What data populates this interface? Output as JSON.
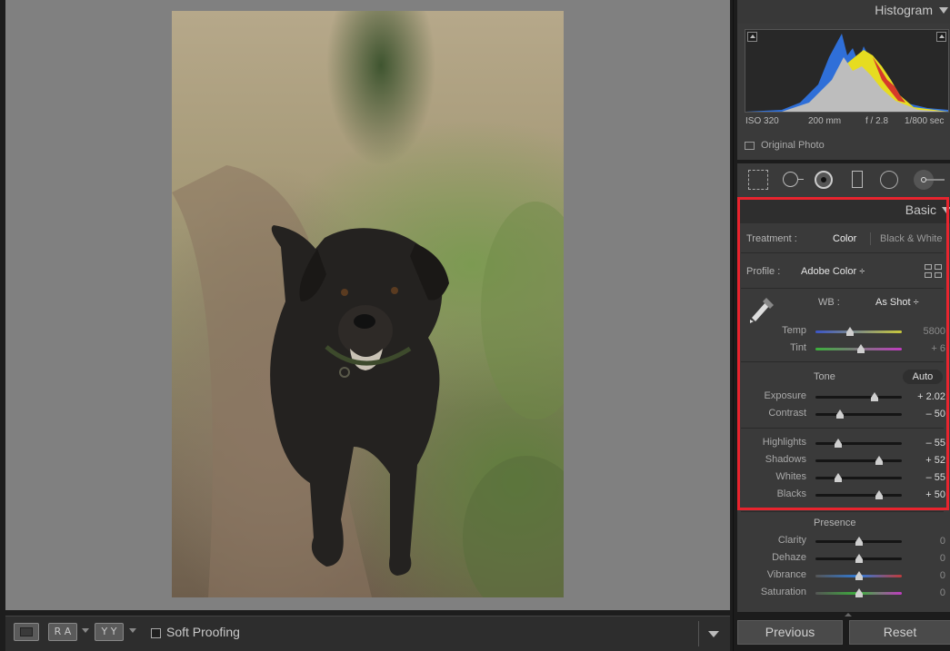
{
  "bottom_toolbar": {
    "ra_label": "R A",
    "yy_label": "Y Y",
    "soft_proofing_label": "Soft Proofing"
  },
  "histogram": {
    "title": "Histogram",
    "iso": "ISO 320",
    "focal": "200 mm",
    "aperture": "f / 2.8",
    "shutter": "1/800 sec",
    "original_photo_label": "Original Photo"
  },
  "basic": {
    "title": "Basic",
    "treatment_label": "Treatment :",
    "treatment_color": "Color",
    "treatment_bw": "Black & White",
    "profile_label": "Profile :",
    "profile_value": "Adobe Color ÷",
    "wb_label": "WB :",
    "wb_value": "As Shot ÷",
    "temp": {
      "label": "Temp",
      "value": "5800",
      "position": 0.4
    },
    "tint": {
      "label": "Tint",
      "value": "+ 6",
      "position": 0.53
    },
    "tone_label": "Tone",
    "auto_label": "Auto",
    "exposure": {
      "label": "Exposure",
      "value": "+ 2.02",
      "position": 0.68
    },
    "contrast": {
      "label": "Contrast",
      "value": "– 50",
      "position": 0.28
    },
    "highlights": {
      "label": "Highlights",
      "value": "– 55",
      "position": 0.26
    },
    "shadows": {
      "label": "Shadows",
      "value": "+ 52",
      "position": 0.74
    },
    "whites": {
      "label": "Whites",
      "value": "– 55",
      "position": 0.26
    },
    "blacks": {
      "label": "Blacks",
      "value": "+ 50",
      "position": 0.74
    },
    "presence_label": "Presence",
    "clarity": {
      "label": "Clarity",
      "value": "0",
      "position": 0.5
    },
    "dehaze": {
      "label": "Dehaze",
      "value": "0",
      "position": 0.5
    },
    "vibrance": {
      "label": "Vibrance",
      "value": "0",
      "position": 0.5
    },
    "saturation": {
      "label": "Saturation",
      "value": "0",
      "position": 0.5
    }
  },
  "footer": {
    "previous_label": "Previous",
    "reset_label": "Reset"
  },
  "colors": {
    "highlight_outline": "#e8242e",
    "panel_bg": "#3a3a3a",
    "canvas_bg": "#808080"
  },
  "icons": [
    "crop-overlay-icon",
    "spot-removal-icon",
    "red-eye-icon",
    "graduated-filter-icon",
    "radial-filter-icon",
    "adjustment-brush-icon",
    "eyedropper-icon",
    "profile-browser-icon"
  ]
}
